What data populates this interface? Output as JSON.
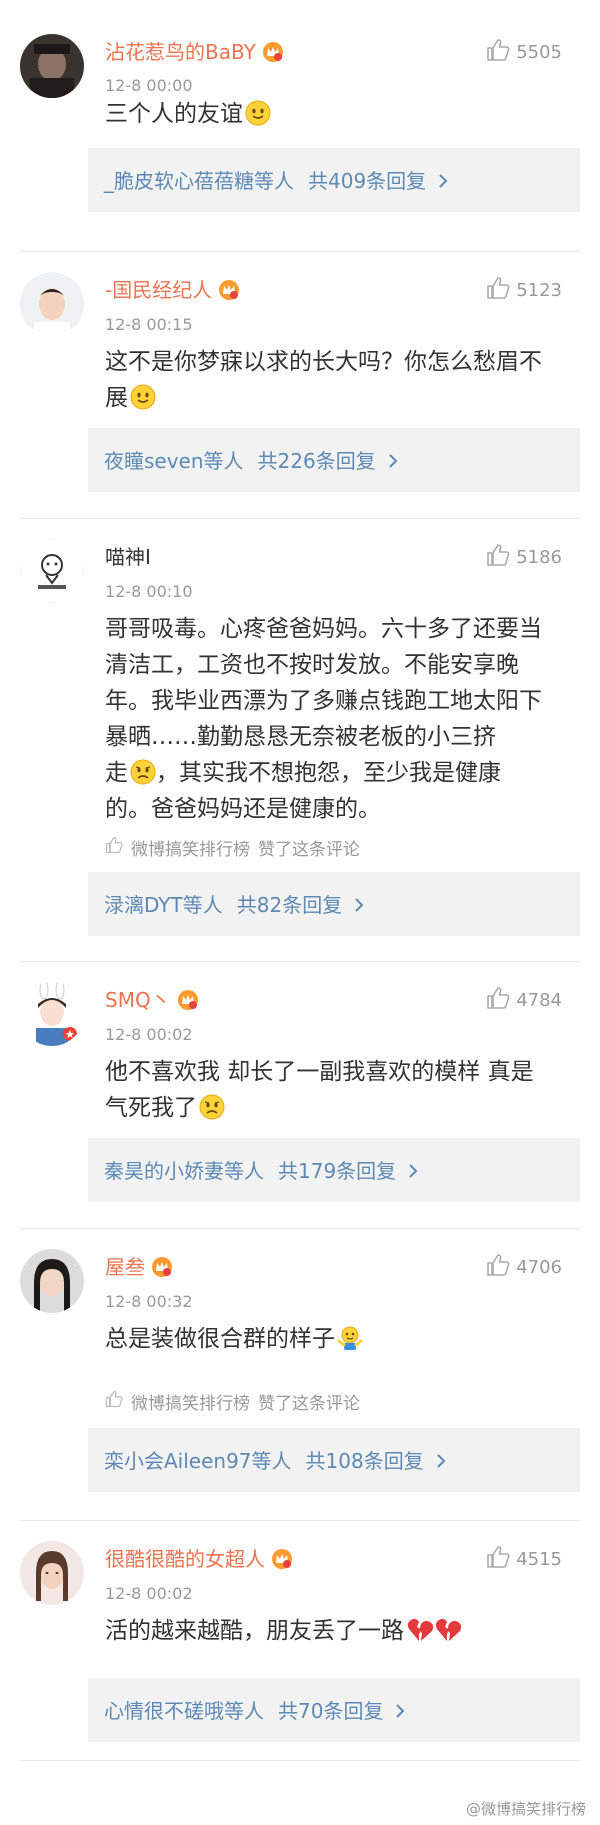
{
  "comments": [
    {
      "username": "沾花惹鸟的BaBY",
      "time": "12-8 00:00",
      "likes": "5505",
      "text_lines": [
        "三个人的友谊"
      ],
      "reply_names": "_脆皮软心蓓蓓糖",
      "reply_suffix": "等人",
      "reply_count": "共409条回复",
      "emoji": "smile-emoji"
    },
    {
      "username": "-国民经纪人",
      "time": "12-8 00:15",
      "likes": "5123",
      "text_lines": [
        "这不是你梦寐以求的长大吗？你怎么愁眉不",
        "展"
      ],
      "reply_names": "夜瞳seven",
      "reply_suffix": "等人",
      "reply_count": "共226条回复",
      "emoji": "smile-emoji"
    },
    {
      "username": "喵神I",
      "time": "12-8 00:10",
      "likes": "5186",
      "text_lines": [
        "哥哥吸毒。心疼爸爸妈妈。六十多了还要当",
        "清洁工，工资也不按时发放。不能安享晚",
        "年。我毕业西漂为了多赚点钱跑工地太阳下",
        "暴晒……勤勤恳恳无奈被老板的小三挤",
        "走",
        "，其实我不想抱怨，至少我是健康",
        "的。爸爸妈妈还是健康的。"
      ],
      "liked_by_name": "微博搞笑排行榜",
      "liked_by_text": "赞了这条评论",
      "reply_names": "渌漓DYT",
      "reply_suffix": "等人",
      "reply_count": "共82条回复",
      "emoji": "sad-emoji"
    },
    {
      "username": "SMQ丶",
      "time": "12-8 00:02",
      "likes": "4784",
      "text_lines": [
        "他不喜欢我 却长了一副我喜欢的模样 真是",
        "气死我了"
      ],
      "reply_names": "秦昊的小娇妻",
      "reply_suffix": "等人",
      "reply_count": "共179条回复",
      "emoji": "sad-emoji"
    },
    {
      "username": "屋叁",
      "time": "12-8 00:32",
      "likes": "4706",
      "text_lines": [
        "总是装做很合群的样子"
      ],
      "liked_by_name": "微博搞笑排行榜",
      "liked_by_text": "赞了这条评论",
      "reply_names": "栾小会Aileen97",
      "reply_suffix": "等人",
      "reply_count": "共108条回复",
      "emoji": "shrug-emoji"
    },
    {
      "username": "很酷很酷的女超人",
      "time": "12-8 00:02",
      "likes": "4515",
      "text_lines": [
        "活的越来越酷，朋友丢了一路"
      ],
      "reply_names": "心情很不磋哦",
      "reply_suffix": "等人",
      "reply_count": "共70条回复",
      "emoji": "broken-heart-emoji"
    }
  ],
  "watermark": "@微博搞笑排行榜",
  "colors": {
    "username": "#eb7350",
    "link": "#5d8ab5",
    "muted": "#999999",
    "text": "#333333",
    "reply_bg": "#f2f2f2"
  }
}
